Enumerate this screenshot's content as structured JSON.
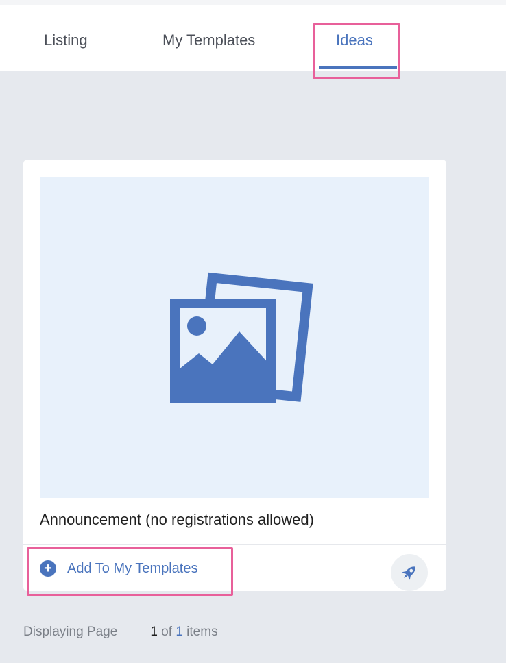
{
  "tabs": [
    {
      "label": "Listing",
      "active": false
    },
    {
      "label": "My Templates",
      "active": false
    },
    {
      "label": "Ideas",
      "active": true
    }
  ],
  "card": {
    "thumbnail_icon": "image-gallery-icon",
    "title": "Announcement (no registrations allowed)",
    "add_label": "Add To My Templates",
    "add_icon": "plus-circle-icon",
    "action_icon": "rocket-icon"
  },
  "pagination": {
    "label": "Displaying Page",
    "current": "1",
    "of": "of",
    "total": "1",
    "suffix": "items"
  },
  "colors": {
    "accent": "#4a74bd",
    "highlight": "#e8609a",
    "background": "#e6e9ee",
    "thumbnail_bg": "#e8f1fb"
  }
}
